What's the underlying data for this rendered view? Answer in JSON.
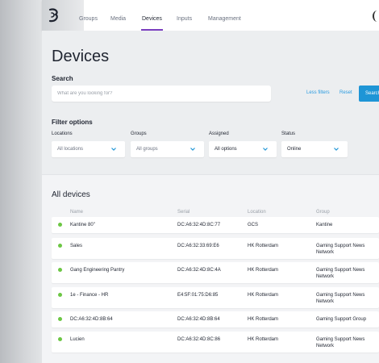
{
  "nav": {
    "tabs": [
      "Groups",
      "Media",
      "Devices",
      "Inputs",
      "Management"
    ],
    "active_tab": "Devices"
  },
  "page": {
    "title": "Devices"
  },
  "search": {
    "label": "Search",
    "placeholder": "What are you looking for?",
    "less_filters": "Less filters",
    "reset": "Reset",
    "button": "Search"
  },
  "filters": {
    "title": "Filter options",
    "locations": {
      "label": "Locations",
      "value": "All locations"
    },
    "groups": {
      "label": "Groups",
      "value": "All groups"
    },
    "assigned": {
      "label": "Assigned",
      "value": "All options"
    },
    "status": {
      "label": "Status",
      "value": "Online"
    }
  },
  "devices": {
    "title": "All devices",
    "columns": {
      "name": "Name",
      "serial": "Serial",
      "location": "Location",
      "group": "Group"
    },
    "rows": [
      {
        "name": "Kantine 80\"",
        "serial": "DC:A6:32:4D:8C:77",
        "location": "GCS",
        "group": "Kantine",
        "status": "online"
      },
      {
        "name": "Sales",
        "serial": "DC:A6:32:33:69:E6",
        "location": "HK Rotterdam",
        "group": "Gaming Support News Network",
        "status": "online"
      },
      {
        "name": "Gang Engineering Pantry",
        "serial": "DC:A6:32:4D:8C:4A",
        "location": "HK Rotterdam",
        "group": "Gaming Support News Network",
        "status": "online"
      },
      {
        "name": "1e - Finance - HR",
        "serial": "E4:5F:01:75:D6:85",
        "location": "HK Rotterdam",
        "group": "Gaming Support News Network",
        "status": "online"
      },
      {
        "name": "DC:A6:32:4D:8B:64",
        "serial": "DC:A6:32:4D:8B:64",
        "location": "HK Rotterdam",
        "group": "Gaming Support Group",
        "status": "online"
      },
      {
        "name": "Lucien",
        "serial": "DC:A6:32:4D:8C:86",
        "location": "HK Rotterdam",
        "group": "Gaming Support News Network",
        "status": "online"
      }
    ]
  },
  "colors": {
    "accent": "#7b3fbf",
    "link": "#2b9be0",
    "primary_button": "#1e95d6",
    "online": "#6cc644"
  }
}
